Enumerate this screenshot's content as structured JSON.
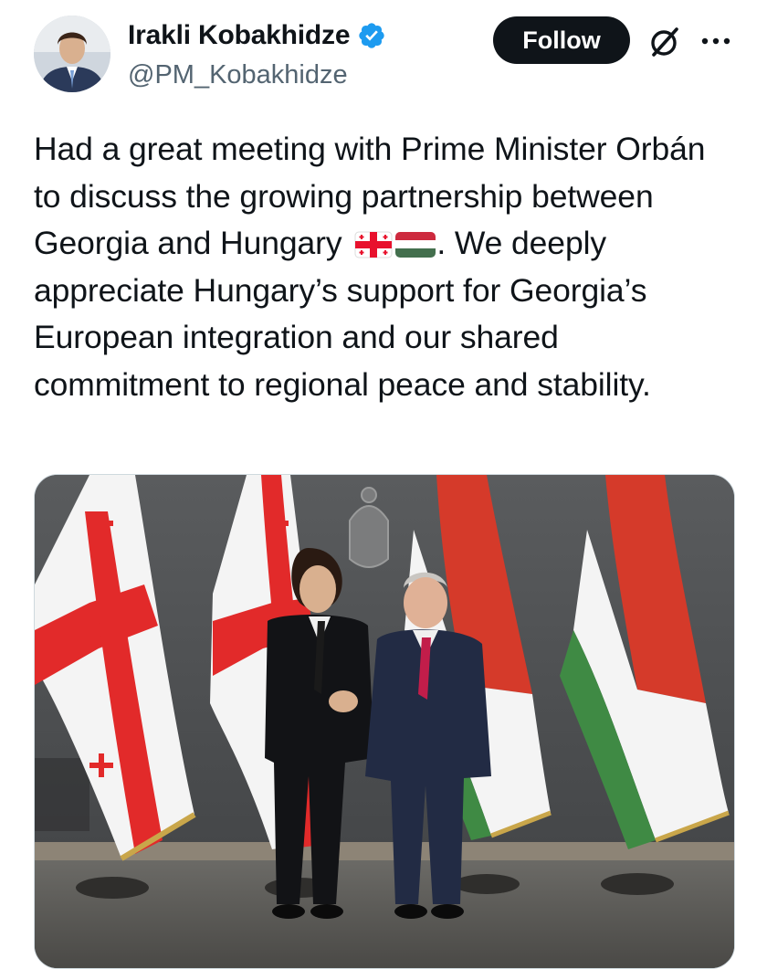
{
  "author": {
    "name": "Irakli Kobakhidze",
    "handle": "@PM_Kobakhidze",
    "verified": true
  },
  "actions": {
    "follow_label": "Follow"
  },
  "tweet": {
    "text_part1": "Had a great meeting with Prime Minister Orbán to discuss the growing partnership between Georgia and Hungary ",
    "text_part2": ". We deeply appreciate Hungary’s support for Georgia’s European integration and our shared commitment to regional peace and stability."
  },
  "colors": {
    "follow_bg": "#0f1419",
    "verified_blue": "#1d9bf0",
    "handle_gray": "#536471",
    "georgia_red": "#e8112d",
    "hungary_red": "#cd2a3e",
    "hungary_green": "#436f4d"
  },
  "icons": {
    "verified": "verified-badge-icon",
    "grok": "grok-icon",
    "more": "more-options-icon",
    "flag_georgia": "georgia-flag-icon",
    "flag_hungary": "hungary-flag-icon"
  }
}
